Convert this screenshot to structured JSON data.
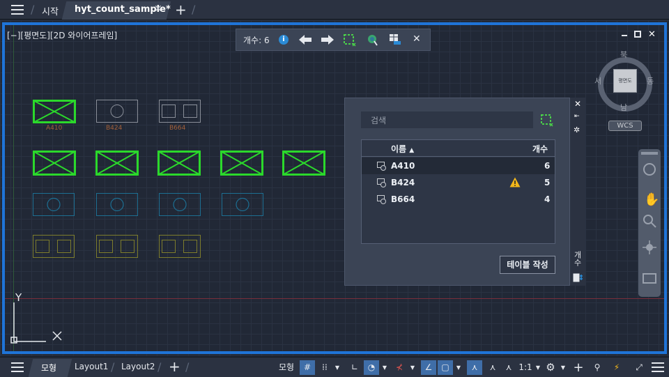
{
  "tabs": {
    "start_label": "시작",
    "file_label": "hyt_count_sample*"
  },
  "viewport": {
    "label": "[−][평면도][2D 와이어프레임]"
  },
  "count_toolbar": {
    "count_label": "개수: 6"
  },
  "blocks": {
    "labels": [
      "A410",
      "B424",
      "B664"
    ]
  },
  "viewcube": {
    "north": "북",
    "south": "남",
    "east": "동",
    "west": "서",
    "face": "평면도",
    "wcs": "WCS"
  },
  "palette": {
    "search_placeholder": "검색",
    "col_name": "이름",
    "col_count": "개수",
    "rows": [
      {
        "name": "A410",
        "count": "6",
        "warning": false
      },
      {
        "name": "B424",
        "count": "5",
        "warning": true
      },
      {
        "name": "B664",
        "count": "4",
        "warning": false
      }
    ],
    "create_table_label": "테이블 작성",
    "side_title": "개수"
  },
  "ucs": {
    "y_label": "Y"
  },
  "statusbar": {
    "layout_tabs": [
      "모형",
      "Layout1",
      "Layout2"
    ],
    "model_button": "모형",
    "scale": "1:1"
  },
  "colors": {
    "accent": "#1f74d8",
    "block_green": "#2bd92b",
    "block_orange_label": "#a3603a",
    "circle_blue": "#1d6f93",
    "square_olive": "#7e7d2c",
    "warning": "#f2b71b"
  }
}
